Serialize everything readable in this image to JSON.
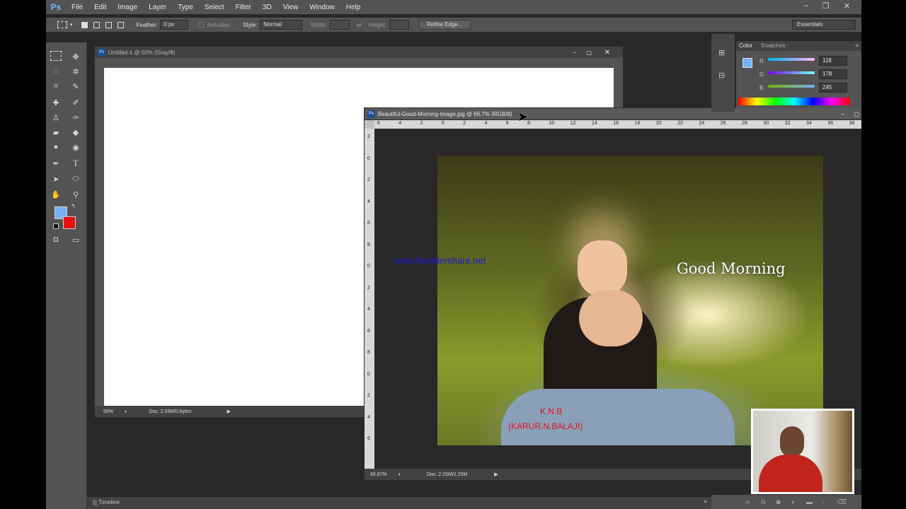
{
  "app": {
    "logo": "Ps",
    "menu": [
      "File",
      "Edit",
      "Image",
      "Layer",
      "Type",
      "Select",
      "Filter",
      "3D",
      "View",
      "Window",
      "Help"
    ]
  },
  "window_controls": {
    "minimize": "–",
    "restore": "❐",
    "close": "✕"
  },
  "options_bar": {
    "feather_label": "Feather:",
    "feather_value": "0 px",
    "antialias_label": "Anti-alias",
    "style_label": "Style:",
    "style_value": "Normal",
    "width_label": "Width:",
    "height_label": "Height:",
    "refine_edge": "Refine Edge...",
    "workspace": "Essentials"
  },
  "doc1": {
    "title": "Untitled-1 @ 50% (Gray/8)",
    "zoom": "50%",
    "doc_info": "Doc: 2.06M/0 bytes"
  },
  "doc2": {
    "title": "Beautiful-Good-Morning-Image.jpg @ 66.7% (RGB/8)",
    "zoom": "66.67%",
    "doc_info": "Doc: 2.25M/2.25M",
    "ruler_h": [
      "6",
      "4",
      "2",
      "0",
      "2",
      "4",
      "6",
      "8",
      "10",
      "12",
      "14",
      "16",
      "18",
      "20",
      "22",
      "24",
      "26",
      "28",
      "30",
      "32",
      "34",
      "36",
      "38"
    ],
    "ruler_v": [
      "2",
      "0",
      "2",
      "4",
      "6",
      "8",
      "0",
      "2",
      "4",
      "6",
      "8",
      "0",
      "2",
      "4",
      "6"
    ]
  },
  "image_text": {
    "watermark": "www.thundershare.net",
    "greeting": "Good Morning",
    "credit_line1": "K.N.B",
    "credit_line2": "(KARUR.N.BALAJI)"
  },
  "color_panel": {
    "tabs": [
      "Color",
      "Swatches"
    ],
    "r_label": "R",
    "g_label": "G",
    "b_label": "B",
    "r": "118",
    "g": "178",
    "b": "245",
    "fg_color": "#76b2f5",
    "bg_color": "#e81010"
  },
  "timeline": {
    "label": "Timeline"
  }
}
